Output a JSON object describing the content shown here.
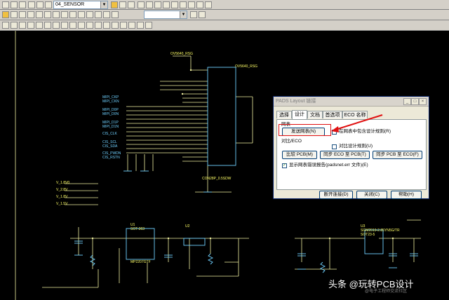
{
  "toolbar": {
    "layer_combo": "04_SENSOR",
    "second_combo": ""
  },
  "dialog": {
    "title": "PADS Layout 链接",
    "tabs": [
      "选择",
      "设计",
      "文档",
      "首选项",
      "ECO 名称"
    ],
    "active_tab": "设计",
    "netlist_group": "网表",
    "send_netlist_button": "发送网表(N)",
    "include_rules_label": "在网表中包含设计规则(R)",
    "include_rules_checked": false,
    "compare_group": "对比/ECO",
    "compare_rules_label": "对比设计规则(U)",
    "compare_rules_checked": false,
    "compare_pcb_button": "比较 PCB(M)",
    "sync_eco_to_pcb_button": "同步 ECO 至 PCB(T)",
    "sync_pcb_to_eco_button": "同步 PCB 至 ECO(F)",
    "show_errors_label": "显示网表错误报告(padsnet.err 文件)(E)",
    "show_errors_checked": true,
    "disconnect_button": "断开连接(D)",
    "close_button": "关闭(C)",
    "help_button": "帮助(H)"
  },
  "schematic": {
    "net_labels_left": [
      "MIPI_CKP",
      "MIPI_CKN",
      "MIPI_D0P",
      "MIPI_D0N",
      "MIPI_D1P",
      "MIPI_D1N",
      "CIS_CLK",
      "CIS_SCL",
      "CIS_SDA",
      "CIS_PWDN",
      "CIS_RSTN"
    ],
    "power_labels": [
      "V_1.8V0",
      "V_2.8V",
      "V_1.8V",
      "V_1.5V"
    ],
    "refs": [
      "OV5640_RSG",
      "U1",
      "U2",
      "U3",
      "CON28P_0.5SDW",
      "SOT-363",
      "MP2207GTF",
      "SGM2019-2.85YN5G/TR",
      "SOT23-5"
    ],
    "top_label": "OV5640_RSG"
  },
  "watermark": {
    "text": "头条 @玩转PCB设计",
    "sub": "@电子工程师交流社区"
  },
  "colors": {
    "wire": "#f2f2a0",
    "component": "#6fd0ff",
    "highlight": "#e01010",
    "background": "#000000"
  }
}
